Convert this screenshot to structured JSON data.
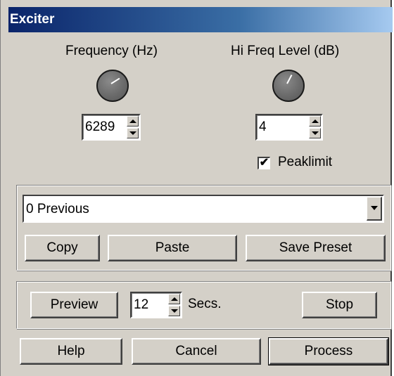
{
  "window": {
    "title": "Exciter"
  },
  "frequency": {
    "label": "Frequency (Hz)",
    "value": "6289"
  },
  "hifreq": {
    "label": "Hi Freq Level (dB)",
    "value": "4"
  },
  "peaklimit": {
    "label": "Peaklimit",
    "checked": true,
    "mark": "✔"
  },
  "preset": {
    "selected": "0 Previous"
  },
  "buttons": {
    "copy": "Copy",
    "paste": "Paste",
    "save_preset": "Save Preset",
    "preview": "Preview",
    "stop": "Stop",
    "help": "Help",
    "cancel": "Cancel",
    "process": "Process"
  },
  "preview": {
    "seconds_value": "12",
    "seconds_unit": "Secs."
  }
}
